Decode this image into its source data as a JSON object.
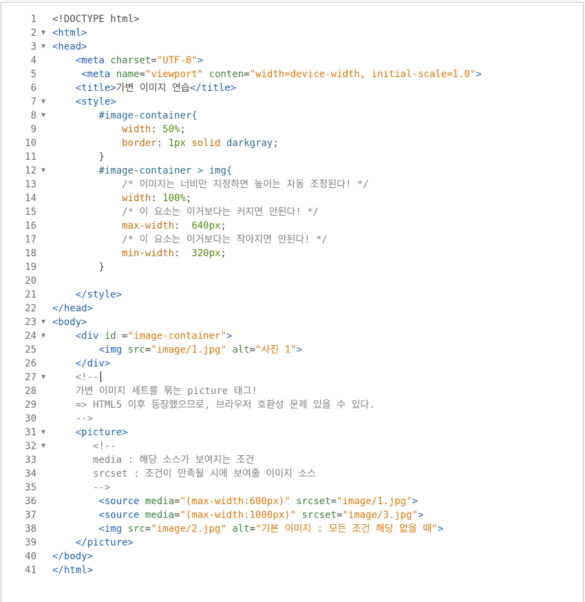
{
  "editor": {
    "lines": [
      {
        "n": "1",
        "fold": false,
        "tokens": [
          {
            "t": "<!DOCTYPE html>",
            "c": "p"
          }
        ]
      },
      {
        "n": "2",
        "fold": true,
        "tokens": [
          {
            "t": "<html>",
            "c": "t"
          }
        ]
      },
      {
        "n": "3",
        "fold": true,
        "tokens": [
          {
            "t": "<head>",
            "c": "t"
          }
        ]
      },
      {
        "n": "4",
        "fold": false,
        "tokens": [
          {
            "t": "    "
          },
          {
            "t": "<meta",
            "c": "t"
          },
          {
            "t": " "
          },
          {
            "t": "charset",
            "c": "a"
          },
          {
            "t": "=",
            "c": "p"
          },
          {
            "t": "\"UTF-8\"",
            "c": "s"
          },
          {
            "t": ">",
            "c": "t"
          }
        ]
      },
      {
        "n": "5",
        "fold": false,
        "tokens": [
          {
            "t": "     "
          },
          {
            "t": "<meta",
            "c": "t"
          },
          {
            "t": " "
          },
          {
            "t": "name",
            "c": "a"
          },
          {
            "t": "=",
            "c": "p"
          },
          {
            "t": "\"viewport\"",
            "c": "s"
          },
          {
            "t": " "
          },
          {
            "t": "conten",
            "c": "a"
          },
          {
            "t": "=",
            "c": "p"
          },
          {
            "t": "\"width=device-width, initial-scale=1.0\"",
            "c": "s"
          },
          {
            "t": ">",
            "c": "t"
          }
        ]
      },
      {
        "n": "6",
        "fold": false,
        "tokens": [
          {
            "t": "    "
          },
          {
            "t": "<title>",
            "c": "t"
          },
          {
            "t": "가변 이미지 연습",
            "c": "p"
          },
          {
            "t": "</title>",
            "c": "t"
          }
        ]
      },
      {
        "n": "7",
        "fold": true,
        "tokens": [
          {
            "t": "    "
          },
          {
            "t": "<style>",
            "c": "t"
          }
        ]
      },
      {
        "n": "8",
        "fold": true,
        "tokens": [
          {
            "t": "        "
          },
          {
            "t": "#image-container{",
            "c": "sel"
          }
        ]
      },
      {
        "n": "9",
        "fold": false,
        "tokens": [
          {
            "t": "            "
          },
          {
            "t": "width",
            "c": "k"
          },
          {
            "t": ": ",
            "c": "p"
          },
          {
            "t": "50%",
            "c": "v"
          },
          {
            "t": ";",
            "c": "p"
          }
        ]
      },
      {
        "n": "10",
        "fold": false,
        "tokens": [
          {
            "t": "            "
          },
          {
            "t": "border",
            "c": "k"
          },
          {
            "t": ": ",
            "c": "p"
          },
          {
            "t": "1px",
            "c": "v"
          },
          {
            "t": " "
          },
          {
            "t": "solid",
            "c": "k"
          },
          {
            "t": " "
          },
          {
            "t": "darkgray",
            "c": "sel"
          },
          {
            "t": ";",
            "c": "p"
          }
        ]
      },
      {
        "n": "11",
        "fold": false,
        "tokens": [
          {
            "t": "        "
          },
          {
            "t": "}",
            "c": "p"
          }
        ]
      },
      {
        "n": "12",
        "fold": true,
        "tokens": [
          {
            "t": "        "
          },
          {
            "t": "#image-container > img{",
            "c": "sel"
          }
        ]
      },
      {
        "n": "13",
        "fold": false,
        "tokens": [
          {
            "t": "            "
          },
          {
            "t": "/* 이미지는 너비만 지정하면 높이는 자동 조정된다! */",
            "c": "c"
          }
        ]
      },
      {
        "n": "14",
        "fold": false,
        "tokens": [
          {
            "t": "            "
          },
          {
            "t": "width",
            "c": "k"
          },
          {
            "t": ": ",
            "c": "p"
          },
          {
            "t": "100%",
            "c": "v"
          },
          {
            "t": ";",
            "c": "p"
          }
        ]
      },
      {
        "n": "15",
        "fold": false,
        "tokens": [
          {
            "t": "            "
          },
          {
            "t": "/* 이 요소는 이거보다는 커지면 안된다! */",
            "c": "c"
          }
        ]
      },
      {
        "n": "16",
        "fold": false,
        "tokens": [
          {
            "t": "            "
          },
          {
            "t": "max-width",
            "c": "k"
          },
          {
            "t": ":  ",
            "c": "p"
          },
          {
            "t": "640px",
            "c": "v"
          },
          {
            "t": ";",
            "c": "p"
          }
        ]
      },
      {
        "n": "17",
        "fold": false,
        "tokens": [
          {
            "t": "            "
          },
          {
            "t": "/* 이 요소는 이거보다는 작아지면 안된다! */",
            "c": "c"
          }
        ]
      },
      {
        "n": "18",
        "fold": false,
        "tokens": [
          {
            "t": "            "
          },
          {
            "t": "min-width",
            "c": "k"
          },
          {
            "t": ":  ",
            "c": "p"
          },
          {
            "t": "320px",
            "c": "v"
          },
          {
            "t": ";",
            "c": "p"
          }
        ]
      },
      {
        "n": "19",
        "fold": false,
        "tokens": [
          {
            "t": "        "
          },
          {
            "t": "}",
            "c": "p"
          }
        ]
      },
      {
        "n": "20",
        "fold": false,
        "tokens": []
      },
      {
        "n": "21",
        "fold": false,
        "tokens": [
          {
            "t": "    "
          },
          {
            "t": "</style>",
            "c": "t"
          }
        ]
      },
      {
        "n": "22",
        "fold": false,
        "tokens": [
          {
            "t": "</head>",
            "c": "t"
          }
        ]
      },
      {
        "n": "23",
        "fold": true,
        "tokens": [
          {
            "t": "<body>",
            "c": "t"
          }
        ]
      },
      {
        "n": "24",
        "fold": true,
        "tokens": [
          {
            "t": "    "
          },
          {
            "t": "<div",
            "c": "t"
          },
          {
            "t": " "
          },
          {
            "t": "id",
            "c": "a"
          },
          {
            "t": " =",
            "c": "p"
          },
          {
            "t": "\"image-container\"",
            "c": "s"
          },
          {
            "t": ">",
            "c": "t"
          }
        ]
      },
      {
        "n": "25",
        "fold": false,
        "tokens": [
          {
            "t": "        "
          },
          {
            "t": "<img",
            "c": "t"
          },
          {
            "t": " "
          },
          {
            "t": "src",
            "c": "a"
          },
          {
            "t": "=",
            "c": "p"
          },
          {
            "t": "\"image/1.jpg\"",
            "c": "s"
          },
          {
            "t": " "
          },
          {
            "t": "alt",
            "c": "a"
          },
          {
            "t": "=",
            "c": "p"
          },
          {
            "t": "\"사진 1\"",
            "c": "s"
          },
          {
            "t": ">",
            "c": "t"
          }
        ]
      },
      {
        "n": "26",
        "fold": false,
        "tokens": [
          {
            "t": "    "
          },
          {
            "t": "</div>",
            "c": "t"
          }
        ]
      },
      {
        "n": "27",
        "fold": true,
        "caret": true,
        "tokens": [
          {
            "t": "    "
          },
          {
            "t": "<!--",
            "c": "c"
          }
        ]
      },
      {
        "n": "28",
        "fold": false,
        "tokens": [
          {
            "t": "    "
          },
          {
            "t": "가변 이미지 세트를 묶는 picture 태그!",
            "c": "c"
          }
        ]
      },
      {
        "n": "29",
        "fold": false,
        "tokens": [
          {
            "t": "    "
          },
          {
            "t": "=> HTML5 이후 등장했으므로, 브라우저 호환성 문제 있을 수 있다.",
            "c": "c"
          }
        ]
      },
      {
        "n": "30",
        "fold": false,
        "tokens": [
          {
            "t": "    "
          },
          {
            "t": "-->",
            "c": "c"
          }
        ]
      },
      {
        "n": "31",
        "fold": true,
        "tokens": [
          {
            "t": "    "
          },
          {
            "t": "<picture>",
            "c": "t"
          }
        ]
      },
      {
        "n": "32",
        "fold": true,
        "tokens": [
          {
            "t": "       "
          },
          {
            "t": "<!--",
            "c": "c"
          }
        ]
      },
      {
        "n": "33",
        "fold": false,
        "tokens": [
          {
            "t": "       "
          },
          {
            "t": "media : 해당 소스가 보여지는 조건",
            "c": "c"
          }
        ]
      },
      {
        "n": "34",
        "fold": false,
        "tokens": [
          {
            "t": "       "
          },
          {
            "t": "srcset : 조건이 만족될 시에 보여줄 이미지 소스",
            "c": "c"
          }
        ]
      },
      {
        "n": "35",
        "fold": false,
        "tokens": [
          {
            "t": "       "
          },
          {
            "t": "-->",
            "c": "c"
          }
        ]
      },
      {
        "n": "36",
        "fold": false,
        "tokens": [
          {
            "t": "        "
          },
          {
            "t": "<source",
            "c": "t"
          },
          {
            "t": " "
          },
          {
            "t": "media",
            "c": "a"
          },
          {
            "t": "=",
            "c": "p"
          },
          {
            "t": "\"(max-width:600px)\"",
            "c": "s"
          },
          {
            "t": " "
          },
          {
            "t": "srcset",
            "c": "a"
          },
          {
            "t": "=",
            "c": "p"
          },
          {
            "t": "\"image/1.jpg\"",
            "c": "s"
          },
          {
            "t": ">",
            "c": "t"
          }
        ]
      },
      {
        "n": "37",
        "fold": false,
        "tokens": [
          {
            "t": "        "
          },
          {
            "t": "<source",
            "c": "t"
          },
          {
            "t": " "
          },
          {
            "t": "media",
            "c": "a"
          },
          {
            "t": "=",
            "c": "p"
          },
          {
            "t": "\"(max-width:1000px)\"",
            "c": "s"
          },
          {
            "t": " "
          },
          {
            "t": "srcset",
            "c": "a"
          },
          {
            "t": "=",
            "c": "p"
          },
          {
            "t": "\"image/3.jpg\"",
            "c": "s"
          },
          {
            "t": ">",
            "c": "t"
          }
        ]
      },
      {
        "n": "38",
        "fold": false,
        "tokens": [
          {
            "t": "        "
          },
          {
            "t": "<img",
            "c": "t"
          },
          {
            "t": " "
          },
          {
            "t": "src",
            "c": "a"
          },
          {
            "t": "=",
            "c": "p"
          },
          {
            "t": "\"image/2.jpg\"",
            "c": "s"
          },
          {
            "t": " "
          },
          {
            "t": "alt",
            "c": "a"
          },
          {
            "t": "=",
            "c": "p"
          },
          {
            "t": "\"기본 이미지 : 모든 조건 해당 없을 때\"",
            "c": "s"
          },
          {
            "t": ">",
            "c": "t"
          }
        ]
      },
      {
        "n": "39",
        "fold": false,
        "tokens": [
          {
            "t": "    "
          },
          {
            "t": "</picture>",
            "c": "t"
          }
        ]
      },
      {
        "n": "40",
        "fold": false,
        "tokens": [
          {
            "t": "</body>",
            "c": "t"
          }
        ]
      },
      {
        "n": "41",
        "fold": false,
        "tokens": [
          {
            "t": "</html>",
            "c": "t"
          }
        ]
      }
    ],
    "colors": {
      "tag": "#1c5fb4",
      "attribute": "#3f7f3f",
      "string": "#d9770b",
      "value": "#4e8a12",
      "property": "#c76b13",
      "comment": "#808080",
      "line_number": "#6b6b6b"
    },
    "icons": {
      "fold": "fold-triangle-icon"
    }
  }
}
